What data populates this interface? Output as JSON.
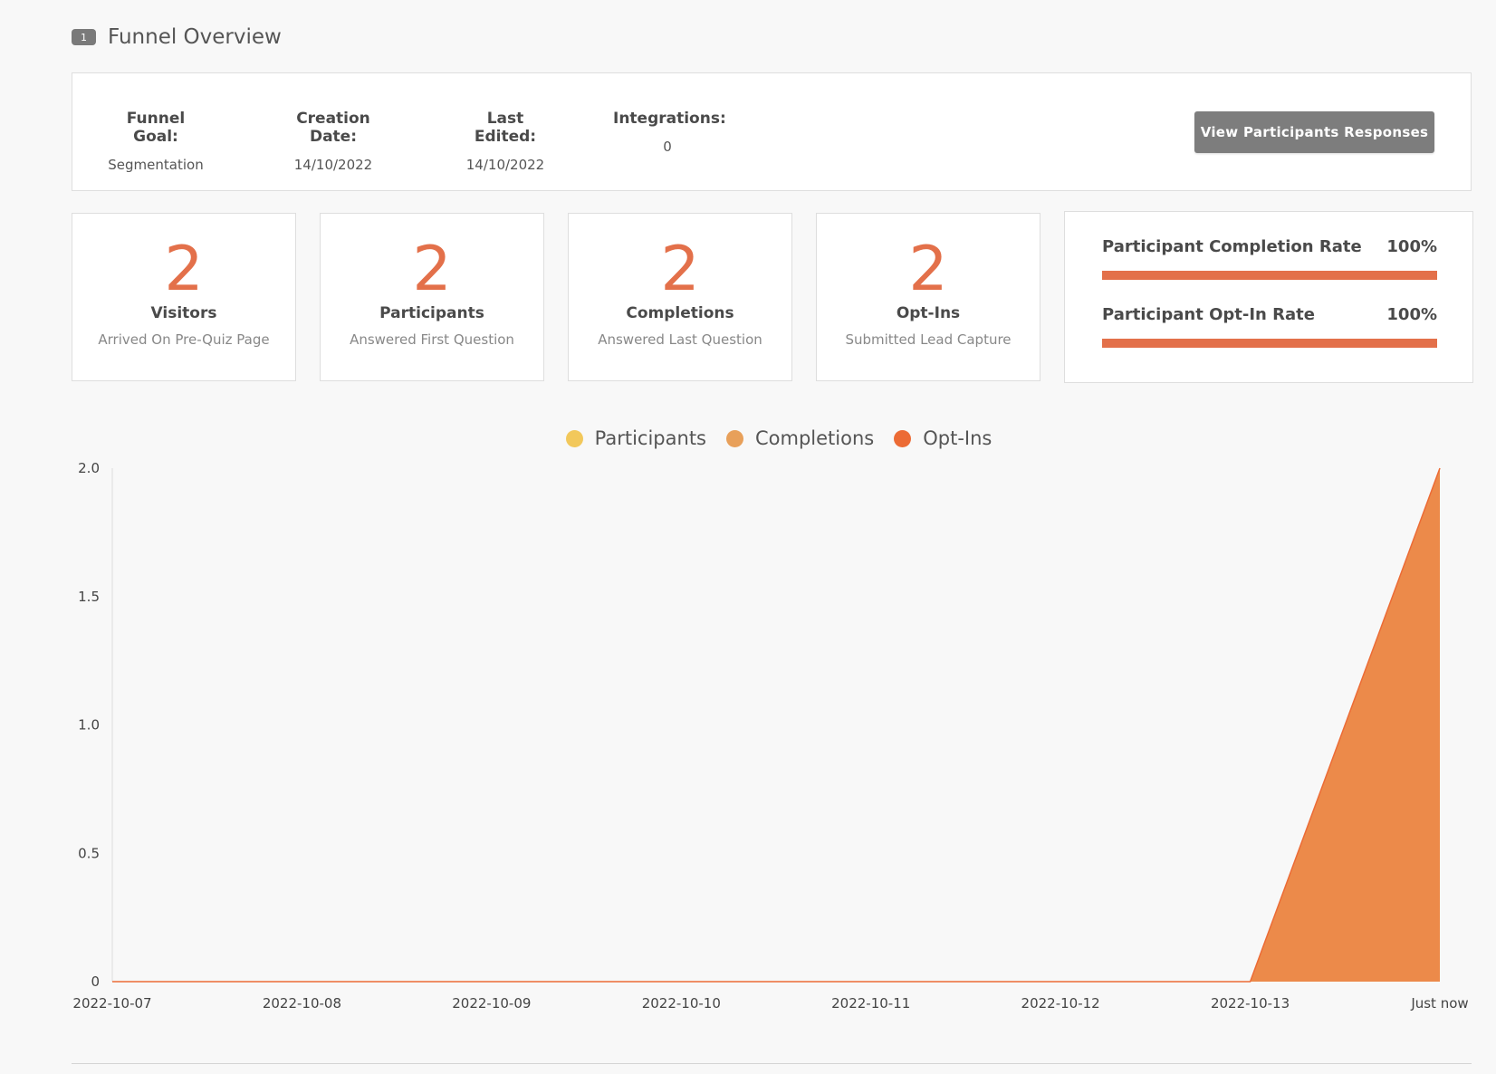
{
  "header": {
    "step": "1",
    "title": "Funnel Overview"
  },
  "info": {
    "goal_label": "Funnel Goal:",
    "goal_value": "Segmentation",
    "created_label": "Creation Date:",
    "created_value": "14/10/2022",
    "edited_label": "Last Edited:",
    "edited_value": "14/10/2022",
    "integrations_label": "Integrations:",
    "integrations_value": "0",
    "view_button": "View Participants Responses"
  },
  "stats": [
    {
      "number": "2",
      "label": "Visitors",
      "sub": "Arrived On Pre-Quiz Page"
    },
    {
      "number": "2",
      "label": "Participants",
      "sub": "Answered First Question"
    },
    {
      "number": "2",
      "label": "Completions",
      "sub": "Answered Last Question"
    },
    {
      "number": "2",
      "label": "Opt-Ins",
      "sub": "Submitted Lead Capture"
    }
  ],
  "rates": [
    {
      "label": "Participant Completion Rate",
      "value": "100%",
      "fraction": 1.0
    },
    {
      "label": "Participant Opt-In Rate",
      "value": "100%",
      "fraction": 1.0
    }
  ],
  "colors": {
    "accent": "#e3704a",
    "participants": "#f2c85b",
    "completions": "#e8a05a",
    "optins": "#ec6b35",
    "area_fill": "#ec8a4a",
    "button": "#7d7d7d"
  },
  "chart_data": {
    "type": "area",
    "categories": [
      "2022-10-07",
      "2022-10-08",
      "2022-10-09",
      "2022-10-10",
      "2022-10-11",
      "2022-10-12",
      "2022-10-13",
      "Just now"
    ],
    "series": [
      {
        "name": "Participants",
        "values": [
          0,
          0,
          0,
          0,
          0,
          0,
          0,
          2
        ]
      },
      {
        "name": "Completions",
        "values": [
          0,
          0,
          0,
          0,
          0,
          0,
          0,
          2
        ]
      },
      {
        "name": "Opt-Ins",
        "values": [
          0,
          0,
          0,
          0,
          0,
          0,
          0,
          2
        ]
      }
    ],
    "yticks": [
      "0",
      "0.5",
      "1.0",
      "1.5",
      "2.0"
    ],
    "ylim": [
      0,
      2
    ],
    "grid": false,
    "legend_position": "top-center"
  }
}
